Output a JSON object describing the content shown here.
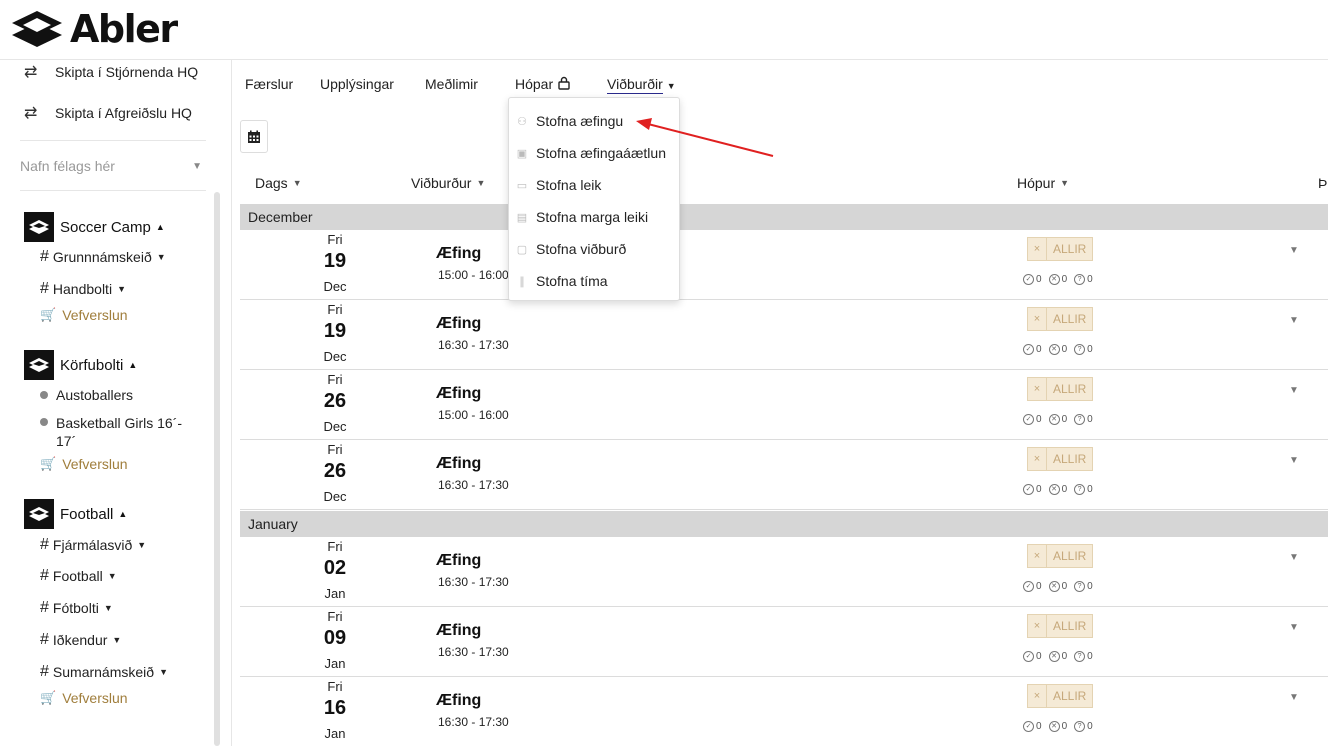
{
  "brand": {
    "name": "Abler"
  },
  "sidebar": {
    "switch_items": [
      {
        "label": "Skipta í Stjórnenda HQ",
        "icon": "swap-icon"
      },
      {
        "label": "Skipta í Afgreiðslu HQ",
        "icon": "swap-icon"
      }
    ],
    "org_placeholder": "Nafn félags hér",
    "clubs": [
      {
        "name": "Soccer Camp",
        "groups": [
          "Grunnnámskeið",
          "Handbolti"
        ],
        "shop": "Vefverslun"
      },
      {
        "name": "Körfubolti",
        "teams": [
          "Austoballers",
          "Basketball Girls 16´- 17´"
        ],
        "shop": "Vefverslun"
      },
      {
        "name": "Football",
        "groups": [
          "Fjármálasvið",
          "Football",
          "Fótbolti",
          "Iðkendur",
          "Sumarnámskeið"
        ],
        "shop": "Vefverslun"
      }
    ]
  },
  "tabs": [
    {
      "label": "Færslur"
    },
    {
      "label": "Upplýsingar"
    },
    {
      "label": "Meðlimir"
    },
    {
      "label": "Hópar"
    },
    {
      "label": "Viðburðir",
      "active": true
    }
  ],
  "columns": {
    "date": "Dags",
    "event": "Viðburður",
    "group": "Hópur",
    "extra": "Þ"
  },
  "dropdown": {
    "items": [
      "Stofna æfingu",
      "Stofna æfingaáætlun",
      "Stofna leik",
      "Stofna marga leiki",
      "Stofna viðburð",
      "Stofna tíma"
    ]
  },
  "months": [
    "December",
    "January"
  ],
  "events": [
    {
      "weekday": "Fri",
      "day": "19",
      "month": "Dec",
      "title": "Æfing",
      "time": "15:00 - 16:00",
      "group": "ALLIR",
      "attending": "0",
      "declined": "0",
      "unknown": "0"
    },
    {
      "weekday": "Fri",
      "day": "19",
      "month": "Dec",
      "title": "Æfing",
      "time": "16:30 - 17:30",
      "group": "ALLIR",
      "attending": "0",
      "declined": "0",
      "unknown": "0"
    },
    {
      "weekday": "Fri",
      "day": "26",
      "month": "Dec",
      "title": "Æfing",
      "time": "15:00 - 16:00",
      "group": "ALLIR",
      "attending": "0",
      "declined": "0",
      "unknown": "0"
    },
    {
      "weekday": "Fri",
      "day": "26",
      "month": "Dec",
      "title": "Æfing",
      "time": "16:30 - 17:30",
      "group": "ALLIR",
      "attending": "0",
      "declined": "0",
      "unknown": "0"
    },
    {
      "weekday": "Fri",
      "day": "02",
      "month": "Jan",
      "title": "Æfing",
      "time": "16:30 - 17:30",
      "group": "ALLIR",
      "attending": "0",
      "declined": "0",
      "unknown": "0"
    },
    {
      "weekday": "Fri",
      "day": "09",
      "month": "Jan",
      "title": "Æfing",
      "time": "16:30 - 17:30",
      "group": "ALLIR",
      "attending": "0",
      "declined": "0",
      "unknown": "0"
    },
    {
      "weekday": "Fri",
      "day": "16",
      "month": "Jan",
      "title": "Æfing",
      "time": "16:30 - 17:30",
      "group": "ALLIR",
      "attending": "0",
      "declined": "0",
      "unknown": "0"
    }
  ],
  "colors": {
    "accent": "#2a2a8c",
    "shop": "#a07e3c",
    "tag_bg": "#f5ead6",
    "arrow": "#e02020"
  }
}
